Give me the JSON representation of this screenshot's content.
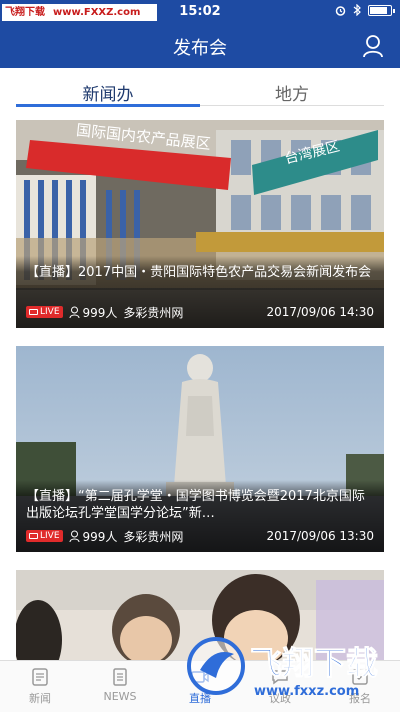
{
  "watermark": {
    "brand": "飞翔下载",
    "url": "www.FXXZ.com",
    "logo_text": "飞翔下载",
    "logo_url": "www.fxxz.com"
  },
  "status_bar": {
    "time": "15:02"
  },
  "header": {
    "title": "发布会"
  },
  "tabs": [
    {
      "label": "新闻办",
      "active": true
    },
    {
      "label": "地方",
      "active": false
    }
  ],
  "cards": [
    {
      "title": "【直播】2017中国・贵阳国际特色农产品交易会新闻发布会",
      "live_label": "LIVE",
      "viewers": "999人",
      "source": "多彩贵州网",
      "date": "2017/09/06 14:30",
      "banners": [
        "国际国内农产品展区",
        "台湾展区"
      ]
    },
    {
      "title": "【直播】“第二届孔学堂・国学图书博览会暨2017北京国际出版论坛孔学堂国学分论坛”新…",
      "live_label": "LIVE",
      "viewers": "999人",
      "source": "多彩贵州网",
      "date": "2017/09/06 13:30"
    },
    {
      "title": ""
    }
  ],
  "bottom_nav": [
    {
      "label": "新闻",
      "icon": "news-icon"
    },
    {
      "label": "NEWS",
      "icon": "document-icon"
    },
    {
      "label": "直播",
      "icon": "live-icon",
      "active": true
    },
    {
      "label": "议政",
      "icon": "discuss-icon"
    },
    {
      "label": "报名",
      "icon": "signup-icon"
    }
  ],
  "colors": {
    "primary": "#1e4ba3",
    "accent": "#2f6dd9",
    "live": "#e02b2b"
  }
}
